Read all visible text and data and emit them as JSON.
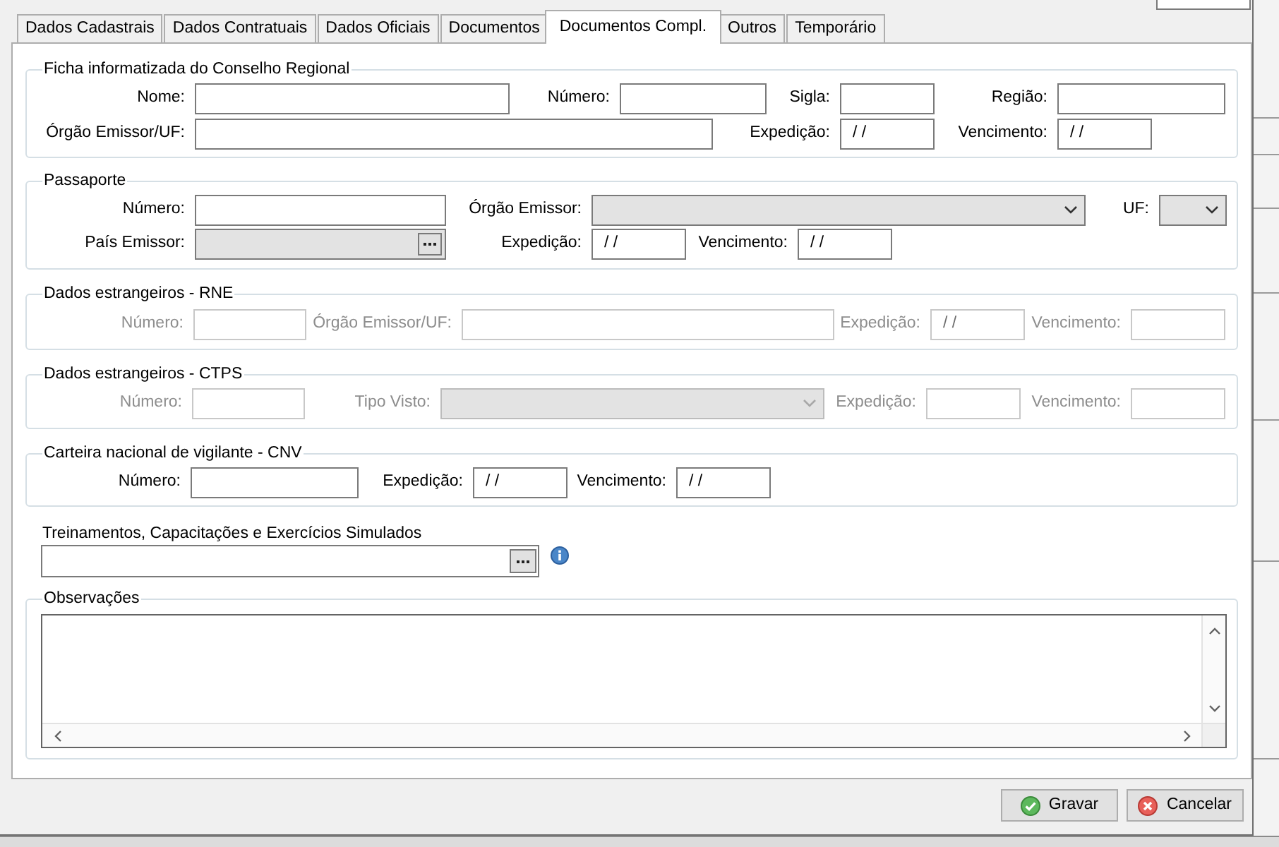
{
  "tabs": [
    {
      "label": "Dados Cadastrais",
      "selected": false
    },
    {
      "label": "Dados Contratuais",
      "selected": false
    },
    {
      "label": "Dados Oficiais",
      "selected": false
    },
    {
      "label": "Documentos",
      "selected": false
    },
    {
      "label": "Documentos Compl.",
      "selected": true
    },
    {
      "label": "Outros",
      "selected": false
    },
    {
      "label": "Temporário",
      "selected": false
    }
  ],
  "groups": [
    {
      "title": "Ficha informatizada do Conselho Regional",
      "disabled": false,
      "fields": [
        {
          "label": "Nome:",
          "kind": "text",
          "read_only": false
        },
        {
          "label": "Número:",
          "kind": "text",
          "read_only": false
        },
        {
          "label": "Sigla:",
          "kind": "text",
          "read_only": false
        },
        {
          "label": "Região:",
          "kind": "text",
          "read_only": false
        },
        {
          "label": "Órgão Emissor/UF:",
          "kind": "text",
          "read_only": false
        },
        {
          "label": "Expedição:",
          "kind": "date",
          "value": "/ /",
          "read_only": false
        },
        {
          "label": "Vencimento:",
          "kind": "date",
          "value": "/ /",
          "read_only": false
        }
      ]
    },
    {
      "title": "Passaporte",
      "disabled": false,
      "fields": [
        {
          "label": "Número:",
          "kind": "text",
          "read_only": false
        },
        {
          "label": "Órgão Emissor:",
          "kind": "select",
          "read_only": true
        },
        {
          "label": "UF:",
          "kind": "select",
          "read_only": true
        },
        {
          "label": "País Emissor:",
          "kind": "lookup",
          "read_only": true
        },
        {
          "label": "Expedição:",
          "kind": "date",
          "value": "/ /",
          "read_only": false
        },
        {
          "label": "Vencimento:",
          "kind": "date",
          "value": "/ /",
          "read_only": false
        }
      ]
    },
    {
      "title": "Dados estrangeiros - RNE",
      "disabled": true,
      "fields": [
        {
          "label": "Número:",
          "kind": "text",
          "read_only": false
        },
        {
          "label": "Órgão Emissor/UF:",
          "kind": "text",
          "read_only": false
        },
        {
          "label": "Expedição:",
          "kind": "date",
          "value": "/ /",
          "read_only": false
        },
        {
          "label": "Vencimento:",
          "kind": "date",
          "read_only": false
        }
      ]
    },
    {
      "title": "Dados estrangeiros - CTPS",
      "disabled": true,
      "fields": [
        {
          "label": "Número:",
          "kind": "text",
          "read_only": false
        },
        {
          "label": "Tipo Visto:",
          "kind": "select",
          "read_only": true
        },
        {
          "label": "Expedição:",
          "kind": "date",
          "read_only": false
        },
        {
          "label": "Vencimento:",
          "kind": "date",
          "read_only": false
        }
      ]
    },
    {
      "title": "Carteira nacional de vigilante - CNV",
      "disabled": false,
      "fields": [
        {
          "label": "Número:",
          "kind": "text",
          "read_only": false
        },
        {
          "label": "Expedição:",
          "kind": "date",
          "value": "/ /",
          "read_only": false
        },
        {
          "label": "Vencimento:",
          "kind": "date",
          "value": "/ /",
          "read_only": false
        }
      ]
    }
  ],
  "training": {
    "label": "Treinamentos, Capacitações e Exercícios Simulados"
  },
  "notes": {
    "title": "Observações"
  },
  "buttons": [
    {
      "label": "Gravar",
      "kind": "confirm"
    },
    {
      "label": "Cancelar",
      "kind": "cancel"
    }
  ]
}
